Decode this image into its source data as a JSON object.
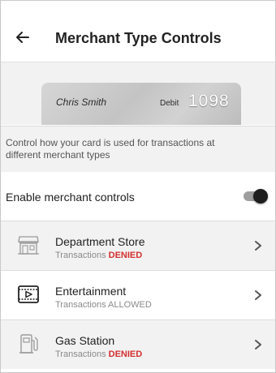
{
  "header": {
    "title": "Merchant Type Controls",
    "back_icon": "arrow-left-icon"
  },
  "card": {
    "holder": "Chris Smith",
    "type": "Debit",
    "last_digits": "1098"
  },
  "description": "Control how your card is used for transactions at different merchant types",
  "controls": {
    "enable_label": "Enable merchant controls",
    "enabled": true
  },
  "merchants": [
    {
      "name": "Department Store",
      "prefix": "Transactions",
      "status": "DENIED",
      "icon": "store-icon"
    },
    {
      "name": "Entertainment",
      "prefix": "Transactions",
      "status": "ALLOWED",
      "icon": "video-player-icon"
    },
    {
      "name": "Gas Station",
      "prefix": "Transactions",
      "status": "DENIED",
      "icon": "gas-pump-icon"
    }
  ],
  "colors": {
    "denied": "#d32f2f",
    "allowed": "#8a8a8a",
    "toggle_thumb": "#1e1e1e"
  }
}
